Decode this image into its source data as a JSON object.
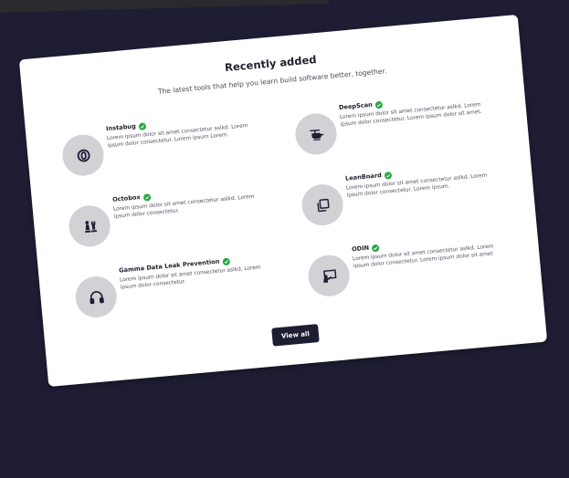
{
  "card": {
    "title": "Recently added",
    "subtitle": "The latest tools that help you learn build software better, together.",
    "view_all_label": "View all"
  },
  "items": [
    {
      "name": "Instabug",
      "icon": "instabug-icon",
      "desc": "Lorem ipsum dolor sit amet consectetur aslkd. Lorem ipsum dolor consectetur. Lorem ipsum Lorem."
    },
    {
      "name": "DeepScan",
      "icon": "helicopter-icon",
      "desc": "Lorem ipsum dolor sit amet consectetur aslkd. Lorem ipsum dolor consectetur. Lorem ipsum dolor sit amet."
    },
    {
      "name": "Octobox",
      "icon": "chess-icon",
      "desc": "Lorem ipsum dolor sit amet consectetur aslkd. Lorem ipsum dolor consectetur."
    },
    {
      "name": "LeanBoard",
      "icon": "copy-icon",
      "desc": "Lorem ipsum dolor sit amet consectetur aslkd. Lorem ipsum dolor consectetur. Lorem ipsum."
    },
    {
      "name": "Gamma Data Leak Prevention",
      "icon": "headphones-icon",
      "desc": "Lorem ipsum dolor sit amet consectetur aslkd. Lorem ipsum dolor consectetur."
    },
    {
      "name": "ODIN",
      "icon": "presentation-icon",
      "desc": "Lorem ipsum dolor sit amet consectetur aslkd. Lorem ipsum dolor consectetur. Lorem ipsum dolor sit amet"
    }
  ],
  "colors": {
    "page_bg": "#1e1d33",
    "card_bg": "#ffffff",
    "icon_bg": "#d2d2d6",
    "verified": "#27a844",
    "button_bg": "#1e1d33"
  }
}
